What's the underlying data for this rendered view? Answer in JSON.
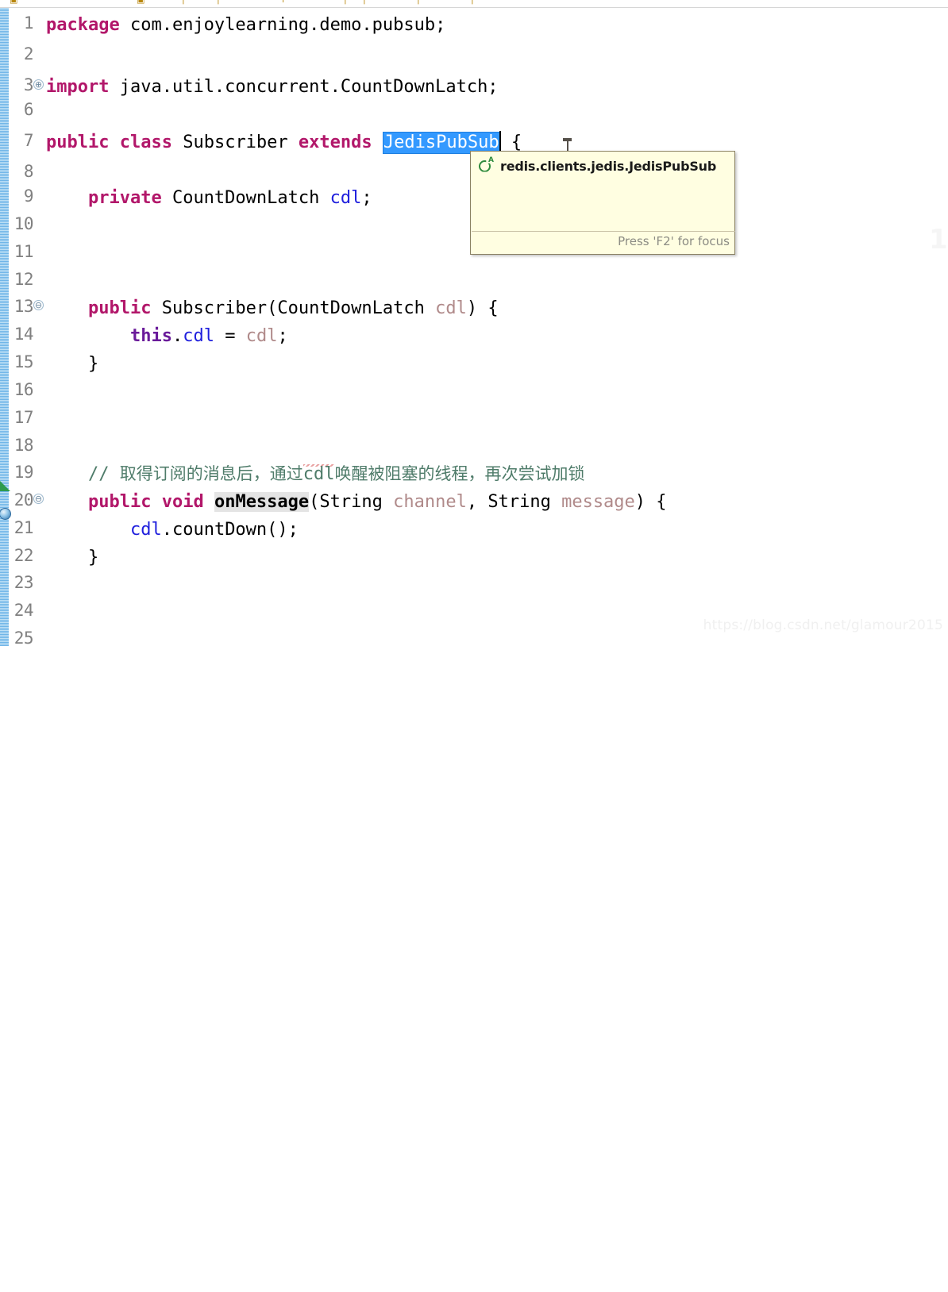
{
  "toolbar": {
    "icons": [
      "toolbar-icon-1",
      "toolbar-icon-2",
      "toolbar-icon-3",
      "toolbar-icon-4",
      "toolbar-icon-5",
      "toolbar-icon-6",
      "toolbar-icon-7",
      "toolbar-icon-8",
      "toolbar-icon-9"
    ]
  },
  "editor": {
    "language": "java",
    "line_numbers": [
      "1",
      "2",
      "3",
      "6",
      "7",
      "8",
      "9",
      "10",
      "11",
      "12",
      "13",
      "14",
      "15",
      "16",
      "17",
      "18",
      "19",
      "20",
      "21",
      "22",
      "23",
      "24",
      "25"
    ],
    "fold_markers": [
      {
        "line": "3",
        "glyph": "⊕",
        "state": "collapsed"
      },
      {
        "line": "13",
        "glyph": "⊖",
        "state": "expanded"
      },
      {
        "line": "20",
        "glyph": "⊖",
        "state": "expanded"
      }
    ],
    "gutter_markers": [
      {
        "line": "20",
        "name": "override-marker"
      },
      {
        "line": "21",
        "name": "bookmark-marker"
      }
    ],
    "code": {
      "l1_kw": "package",
      "l1_rest": " com.enjoylearning.demo.pubsub;",
      "l3_kw": "import",
      "l3_rest": " java.util.concurrent.CountDownLatch;",
      "l7_kw1": "public",
      "l7_kw2": "class",
      "l7_name": " Subscriber ",
      "l7_kw3": "extends",
      "l7_sel": "JedisPubSub",
      "l7_brace": " {",
      "l9_kw": "private",
      "l9_type": " CountDownLatch ",
      "l9_field": "cdl",
      "l9_end": ";",
      "l13_kw": "public",
      "l13_sig": " Subscriber(CountDownLatch ",
      "l13_param": "cdl",
      "l13_end": ") {",
      "l14_this": "this",
      "l14_dot": ".",
      "l14_field": "cdl",
      "l14_eq": " = ",
      "l14_param": "cdl",
      "l14_end": ";",
      "l15": "}",
      "l19_comment_slashes": "// ",
      "l19_comment_cn_a": "取得订阅的消息后，通过",
      "l19_comment_code": "cdl",
      "l19_comment_cn_b": "唤醒被阻塞的线程，再次尝试加锁",
      "l20_kw1": "public",
      "l20_kw2": " void ",
      "l20_method": "onMessage",
      "l20_open": "(String ",
      "l20_param1": "channel",
      "l20_mid": ", String ",
      "l20_param2": "message",
      "l20_end": ") {",
      "l21_field": "cdl",
      "l21_call": ".countDown();",
      "l22": "}"
    }
  },
  "tooltip": {
    "icon": "abstract-class-icon",
    "icon_letter": "C",
    "icon_superscript": "A",
    "title": "redis.clients.jedis.JedisPubSub",
    "footer": "Press 'F2' for focus"
  },
  "watermark": {
    "url": "https://blog.csdn.net/glamour2015",
    "ghost": "1"
  },
  "colors": {
    "keyword": "#b2176a",
    "field": "#1f1fdd",
    "parameter": "#b08a8a",
    "comment": "#4f7c6a",
    "selection": "#3399ff",
    "tooltip_bg": "#fffee1",
    "change_bar": "#6fb5e8"
  }
}
